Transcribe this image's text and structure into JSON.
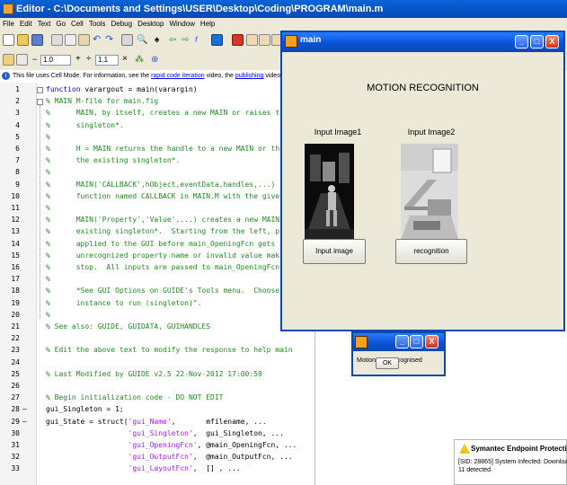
{
  "editor": {
    "title": "Editor - C:\\Documents and Settings\\USER\\Desktop\\Coding\\PROGRAM\\main.m",
    "menu": [
      "File",
      "Edit",
      "Text",
      "Go",
      "Cell",
      "Tools",
      "Debug",
      "Desktop",
      "Window",
      "Help"
    ],
    "toolbar2": {
      "minus": "−",
      "value1": "1.0",
      "plus": "+",
      "divide": "÷",
      "value2": "1.1",
      "times": "×"
    },
    "info_prefix": "This file uses Cell Mode. For information, see the ",
    "info_link1": "rapid code iteration",
    "info_mid": " video, the ",
    "info_link2": "publishing",
    "info_mid2": " video, or ",
    "info_link3": "help",
    "info_end": ".",
    "lines": [
      {
        "n": "1",
        "b": "",
        "segs": [
          {
            "c": "kw",
            "t": "function"
          },
          {
            "c": "",
            "t": " varargout = main(varargin)"
          }
        ]
      },
      {
        "n": "2",
        "b": "",
        "segs": [
          {
            "c": "cm",
            "t": "% MAIN M-file for main.fig"
          }
        ]
      },
      {
        "n": "3",
        "b": "",
        "segs": [
          {
            "c": "cm",
            "t": "%      MAIN, by itself, creates a new MAIN or raises the existin"
          }
        ]
      },
      {
        "n": "4",
        "b": "",
        "segs": [
          {
            "c": "cm",
            "t": "%      singleton*."
          }
        ]
      },
      {
        "n": "5",
        "b": "",
        "segs": [
          {
            "c": "cm",
            "t": "%"
          }
        ]
      },
      {
        "n": "6",
        "b": "",
        "segs": [
          {
            "c": "cm",
            "t": "%      H = MAIN returns the handle to a new MAIN or the handle t"
          }
        ]
      },
      {
        "n": "7",
        "b": "",
        "segs": [
          {
            "c": "cm",
            "t": "%      the existing singleton*."
          }
        ]
      },
      {
        "n": "8",
        "b": "",
        "segs": [
          {
            "c": "cm",
            "t": "%"
          }
        ]
      },
      {
        "n": "9",
        "b": "",
        "segs": [
          {
            "c": "cm",
            "t": "%      MAIN('CALLBACK',hObject,eventData,handles,...) calls the"
          }
        ]
      },
      {
        "n": "10",
        "b": "",
        "segs": [
          {
            "c": "cm",
            "t": "%      function named CALLBACK in MAIN.M with the given input ar"
          }
        ]
      },
      {
        "n": "11",
        "b": "",
        "segs": [
          {
            "c": "cm",
            "t": "%"
          }
        ]
      },
      {
        "n": "12",
        "b": "",
        "segs": [
          {
            "c": "cm",
            "t": "%      MAIN('Property','Value',...) creates a new MAIN or raises"
          }
        ]
      },
      {
        "n": "13",
        "b": "",
        "segs": [
          {
            "c": "cm",
            "t": "%      existing singleton*.  Starting from the left, property va"
          }
        ]
      },
      {
        "n": "14",
        "b": "",
        "segs": [
          {
            "c": "cm",
            "t": "%      applied to the GUI before main_OpeningFcn gets called.  A"
          }
        ]
      },
      {
        "n": "15",
        "b": "",
        "segs": [
          {
            "c": "cm",
            "t": "%      unrecognized property name or invalid value makes propert"
          }
        ]
      },
      {
        "n": "16",
        "b": "",
        "segs": [
          {
            "c": "cm",
            "t": "%      stop.  All inputs are passed to main_OpeningFcn via varar"
          }
        ]
      },
      {
        "n": "17",
        "b": "",
        "segs": [
          {
            "c": "cm",
            "t": "%"
          }
        ]
      },
      {
        "n": "18",
        "b": "",
        "segs": [
          {
            "c": "cm",
            "t": "%      *See GUI Options on GUIDE's Tools menu.  Choose \"GUI allo"
          }
        ]
      },
      {
        "n": "19",
        "b": "",
        "segs": [
          {
            "c": "cm",
            "t": "%      instance to run (singleton)\"."
          }
        ]
      },
      {
        "n": "20",
        "b": "",
        "segs": [
          {
            "c": "cm",
            "t": "%"
          }
        ]
      },
      {
        "n": "21",
        "b": "",
        "segs": [
          {
            "c": "cm",
            "t": "% See also: GUIDE, GUIDATA, GUIHANDLES"
          }
        ]
      },
      {
        "n": "22",
        "b": "",
        "segs": []
      },
      {
        "n": "23",
        "b": "",
        "segs": [
          {
            "c": "cm",
            "t": "% Edit the above text to modify the response to help main"
          }
        ]
      },
      {
        "n": "24",
        "b": "",
        "segs": []
      },
      {
        "n": "25",
        "b": "",
        "segs": [
          {
            "c": "cm",
            "t": "% Last Modified by GUIDE v2.5 22-Nov-2012 17:00:59"
          }
        ]
      },
      {
        "n": "26",
        "b": "",
        "segs": []
      },
      {
        "n": "27",
        "b": "",
        "segs": [
          {
            "c": "cm",
            "t": "% Begin initialization code - DO NOT EDIT"
          }
        ]
      },
      {
        "n": "28",
        "b": "–",
        "segs": [
          {
            "c": "",
            "t": "gui_Singleton = 1;"
          }
        ]
      },
      {
        "n": "29",
        "b": "–",
        "segs": [
          {
            "c": "",
            "t": "gui_State = struct("
          },
          {
            "c": "st",
            "t": "'gui_Name'"
          },
          {
            "c": "",
            "t": ",       mfilename, ..."
          }
        ]
      },
      {
        "n": "30",
        "b": "",
        "segs": [
          {
            "c": "",
            "t": "                   "
          },
          {
            "c": "st",
            "t": "'gui_Singleton'"
          },
          {
            "c": "",
            "t": ",  gui_Singleton, ..."
          }
        ]
      },
      {
        "n": "31",
        "b": "",
        "segs": [
          {
            "c": "",
            "t": "                   "
          },
          {
            "c": "st",
            "t": "'gui_OpeningFcn'"
          },
          {
            "c": "",
            "t": ", @main_OpeningFcn, ..."
          }
        ]
      },
      {
        "n": "32",
        "b": "",
        "segs": [
          {
            "c": "",
            "t": "                   "
          },
          {
            "c": "st",
            "t": "'gui_OutputFcn'"
          },
          {
            "c": "",
            "t": ",  @main_OutputFcn, ..."
          }
        ]
      },
      {
        "n": "33",
        "b": "",
        "segs": [
          {
            "c": "",
            "t": "                   "
          },
          {
            "c": "st",
            "t": "'gui_LayoutFcn'"
          },
          {
            "c": "",
            "t": ",  [] , ..."
          }
        ]
      }
    ]
  },
  "figure": {
    "title": "main",
    "heading": "MOTION RECOGNITION",
    "label1": "Input Image1",
    "label2": "Input Image2",
    "button_input": "Input image",
    "button_recognition": "recognition"
  },
  "dialog": {
    "message": "Motion Not Recognised",
    "ok": "OK"
  },
  "symantec": {
    "title": "Symantec Endpoint Protection",
    "line1": "[SID: 28865] System Infected: Downloader.Dron",
    "line2": "11 detected"
  },
  "colors": {
    "titlebar": "#0a4ab0",
    "keyword": "#0000ff",
    "comment": "#228b22",
    "string": "#a020f0",
    "window_bg": "#ece9d8"
  }
}
